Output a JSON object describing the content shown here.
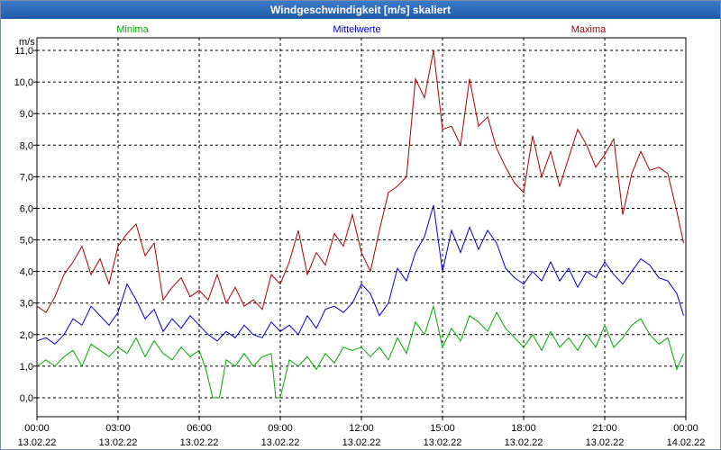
{
  "window": {
    "title": "Windgeschwindigkeit [m/s] skaliert"
  },
  "colors": {
    "minima": "#00aa00",
    "mittelwerte": "#0000cc",
    "maxima": "#aa0000",
    "grid": "#000000",
    "titlebar": "#2a66b4"
  },
  "chart_data": {
    "type": "line",
    "title": "Windgeschwindigkeit [m/s] skaliert",
    "ylabel": "m/s",
    "xlabel": "",
    "ylim": [
      -0.6,
      11.4
    ],
    "xlim": [
      "2022-02-13T00:00",
      "2022-02-14T00:00"
    ],
    "grid": true,
    "legend_position": "top",
    "y_ticks": [
      "0,0",
      "1,0",
      "2,0",
      "3,0",
      "4,0",
      "5,0",
      "6,0",
      "7,0",
      "8,0",
      "9,0",
      "10,0",
      "11,0"
    ],
    "x_ticks": [
      {
        "time": "00:00",
        "date": "13.02.22"
      },
      {
        "time": "03:00",
        "date": "13.02.22"
      },
      {
        "time": "06:00",
        "date": "13.02.22"
      },
      {
        "time": "09:00",
        "date": "13.02.22"
      },
      {
        "time": "12:00",
        "date": "13.02.22"
      },
      {
        "time": "15:00",
        "date": "13.02.22"
      },
      {
        "time": "18:00",
        "date": "13.02.22"
      },
      {
        "time": "21:00",
        "date": "13.02.22"
      },
      {
        "time": "00:00",
        "date": "14.02.22"
      }
    ],
    "series": [
      {
        "name": "Minima",
        "values": [
          [
            "00:00",
            1.0
          ],
          [
            "00:20",
            1.2
          ],
          [
            "00:40",
            1.0
          ],
          [
            "01:00",
            1.3
          ],
          [
            "01:20",
            1.5
          ],
          [
            "01:40",
            1.0
          ],
          [
            "02:00",
            1.7
          ],
          [
            "02:20",
            1.5
          ],
          [
            "02:40",
            1.3
          ],
          [
            "03:00",
            1.6
          ],
          [
            "03:20",
            1.4
          ],
          [
            "03:40",
            1.9
          ],
          [
            "04:00",
            1.3
          ],
          [
            "04:20",
            1.8
          ],
          [
            "04:40",
            1.4
          ],
          [
            "05:00",
            1.2
          ],
          [
            "05:20",
            1.6
          ],
          [
            "05:40",
            1.3
          ],
          [
            "06:00",
            1.5
          ],
          [
            "06:15",
            0.9
          ],
          [
            "06:30",
            0.0
          ],
          [
            "06:45",
            0.0
          ],
          [
            "07:00",
            1.2
          ],
          [
            "07:20",
            1.0
          ],
          [
            "07:40",
            1.4
          ],
          [
            "08:00",
            1.0
          ],
          [
            "08:20",
            1.3
          ],
          [
            "08:40",
            1.4
          ],
          [
            "08:50",
            0.0
          ],
          [
            "09:00",
            0.0
          ],
          [
            "09:20",
            1.2
          ],
          [
            "09:40",
            1.0
          ],
          [
            "10:00",
            1.3
          ],
          [
            "10:20",
            0.9
          ],
          [
            "10:40",
            1.4
          ],
          [
            "11:00",
            1.1
          ],
          [
            "11:20",
            1.6
          ],
          [
            "11:40",
            1.5
          ],
          [
            "12:00",
            1.6
          ],
          [
            "12:20",
            1.3
          ],
          [
            "12:40",
            1.6
          ],
          [
            "13:00",
            1.2
          ],
          [
            "13:20",
            1.9
          ],
          [
            "13:40",
            1.4
          ],
          [
            "14:00",
            2.4
          ],
          [
            "14:20",
            2.0
          ],
          [
            "14:40",
            2.9
          ],
          [
            "15:00",
            1.6
          ],
          [
            "15:20",
            2.2
          ],
          [
            "15:40",
            1.8
          ],
          [
            "16:00",
            2.6
          ],
          [
            "16:20",
            2.4
          ],
          [
            "16:40",
            2.1
          ],
          [
            "17:00",
            2.7
          ],
          [
            "17:20",
            2.2
          ],
          [
            "17:40",
            1.9
          ],
          [
            "18:00",
            1.6
          ],
          [
            "18:20",
            2.0
          ],
          [
            "18:40",
            1.5
          ],
          [
            "19:00",
            2.1
          ],
          [
            "19:20",
            1.6
          ],
          [
            "19:40",
            1.9
          ],
          [
            "20:00",
            1.5
          ],
          [
            "20:20",
            2.0
          ],
          [
            "20:40",
            1.6
          ],
          [
            "21:00",
            2.3
          ],
          [
            "21:20",
            1.6
          ],
          [
            "21:40",
            1.9
          ],
          [
            "22:00",
            2.3
          ],
          [
            "22:20",
            2.5
          ],
          [
            "22:40",
            2.0
          ],
          [
            "23:00",
            1.7
          ],
          [
            "23:20",
            1.9
          ],
          [
            "23:40",
            0.9
          ],
          [
            "23:55",
            1.4
          ]
        ]
      },
      {
        "name": "Mittelwerte",
        "values": [
          [
            "00:00",
            1.8
          ],
          [
            "00:20",
            1.9
          ],
          [
            "00:40",
            1.7
          ],
          [
            "01:00",
            2.0
          ],
          [
            "01:20",
            2.5
          ],
          [
            "01:40",
            2.3
          ],
          [
            "02:00",
            2.9
          ],
          [
            "02:20",
            2.6
          ],
          [
            "02:40",
            2.3
          ],
          [
            "03:00",
            2.7
          ],
          [
            "03:20",
            3.6
          ],
          [
            "03:40",
            3.1
          ],
          [
            "04:00",
            2.5
          ],
          [
            "04:20",
            2.8
          ],
          [
            "04:40",
            2.1
          ],
          [
            "05:00",
            2.5
          ],
          [
            "05:20",
            2.2
          ],
          [
            "05:40",
            2.6
          ],
          [
            "06:00",
            2.3
          ],
          [
            "06:20",
            2.0
          ],
          [
            "06:40",
            1.8
          ],
          [
            "07:00",
            2.1
          ],
          [
            "07:20",
            1.9
          ],
          [
            "07:40",
            2.3
          ],
          [
            "08:00",
            2.0
          ],
          [
            "08:20",
            1.9
          ],
          [
            "08:40",
            2.4
          ],
          [
            "09:00",
            2.1
          ],
          [
            "09:20",
            2.3
          ],
          [
            "09:40",
            2.0
          ],
          [
            "10:00",
            2.6
          ],
          [
            "10:20",
            2.2
          ],
          [
            "10:40",
            2.8
          ],
          [
            "11:00",
            2.9
          ],
          [
            "11:20",
            2.7
          ],
          [
            "11:40",
            3.0
          ],
          [
            "12:00",
            3.6
          ],
          [
            "12:20",
            3.3
          ],
          [
            "12:40",
            2.6
          ],
          [
            "13:00",
            3.0
          ],
          [
            "13:20",
            4.1
          ],
          [
            "13:40",
            3.7
          ],
          [
            "14:00",
            4.6
          ],
          [
            "14:20",
            5.1
          ],
          [
            "14:40",
            6.1
          ],
          [
            "15:00",
            4.0
          ],
          [
            "15:20",
            5.3
          ],
          [
            "15:40",
            4.6
          ],
          [
            "16:00",
            5.4
          ],
          [
            "16:20",
            4.7
          ],
          [
            "16:40",
            5.3
          ],
          [
            "17:00",
            4.9
          ],
          [
            "17:20",
            4.1
          ],
          [
            "17:40",
            3.8
          ],
          [
            "18:00",
            3.6
          ],
          [
            "18:20",
            4.0
          ],
          [
            "18:40",
            3.7
          ],
          [
            "19:00",
            4.3
          ],
          [
            "19:20",
            3.7
          ],
          [
            "19:40",
            4.1
          ],
          [
            "20:00",
            3.5
          ],
          [
            "20:20",
            4.0
          ],
          [
            "20:40",
            3.8
          ],
          [
            "21:00",
            4.3
          ],
          [
            "21:20",
            3.9
          ],
          [
            "21:40",
            3.6
          ],
          [
            "22:00",
            4.0
          ],
          [
            "22:20",
            4.4
          ],
          [
            "22:40",
            4.2
          ],
          [
            "23:00",
            3.8
          ],
          [
            "23:20",
            3.7
          ],
          [
            "23:40",
            3.3
          ],
          [
            "23:55",
            2.6
          ]
        ]
      },
      {
        "name": "Maxima",
        "values": [
          [
            "00:00",
            2.9
          ],
          [
            "00:20",
            2.7
          ],
          [
            "00:40",
            3.2
          ],
          [
            "01:00",
            3.9
          ],
          [
            "01:20",
            4.3
          ],
          [
            "01:40",
            4.8
          ],
          [
            "02:00",
            3.9
          ],
          [
            "02:20",
            4.4
          ],
          [
            "02:40",
            3.6
          ],
          [
            "03:00",
            4.8
          ],
          [
            "03:20",
            5.2
          ],
          [
            "03:40",
            5.5
          ],
          [
            "04:00",
            4.5
          ],
          [
            "04:20",
            4.9
          ],
          [
            "04:40",
            3.1
          ],
          [
            "05:00",
            3.5
          ],
          [
            "05:20",
            3.8
          ],
          [
            "05:40",
            3.2
          ],
          [
            "06:00",
            3.4
          ],
          [
            "06:20",
            3.1
          ],
          [
            "06:40",
            3.9
          ],
          [
            "07:00",
            3.0
          ],
          [
            "07:20",
            3.5
          ],
          [
            "07:40",
            2.9
          ],
          [
            "08:00",
            3.1
          ],
          [
            "08:20",
            2.8
          ],
          [
            "08:40",
            3.9
          ],
          [
            "09:00",
            3.6
          ],
          [
            "09:20",
            4.3
          ],
          [
            "09:40",
            5.3
          ],
          [
            "10:00",
            3.9
          ],
          [
            "10:20",
            4.6
          ],
          [
            "10:40",
            4.2
          ],
          [
            "11:00",
            5.2
          ],
          [
            "11:20",
            4.8
          ],
          [
            "11:40",
            5.8
          ],
          [
            "12:00",
            4.6
          ],
          [
            "12:20",
            4.0
          ],
          [
            "12:40",
            5.3
          ],
          [
            "13:00",
            6.5
          ],
          [
            "13:20",
            6.7
          ],
          [
            "13:40",
            7.0
          ],
          [
            "14:00",
            10.1
          ],
          [
            "14:20",
            9.5
          ],
          [
            "14:40",
            11.0
          ],
          [
            "15:00",
            8.5
          ],
          [
            "15:20",
            8.6
          ],
          [
            "15:40",
            8.0
          ],
          [
            "16:00",
            10.1
          ],
          [
            "16:20",
            8.6
          ],
          [
            "16:40",
            8.9
          ],
          [
            "17:00",
            7.9
          ],
          [
            "17:20",
            7.3
          ],
          [
            "17:40",
            6.8
          ],
          [
            "18:00",
            6.5
          ],
          [
            "18:20",
            8.3
          ],
          [
            "18:40",
            7.0
          ],
          [
            "19:00",
            7.8
          ],
          [
            "19:20",
            6.7
          ],
          [
            "19:40",
            7.6
          ],
          [
            "20:00",
            8.5
          ],
          [
            "20:20",
            8.0
          ],
          [
            "20:40",
            7.3
          ],
          [
            "21:00",
            7.7
          ],
          [
            "21:20",
            8.2
          ],
          [
            "21:40",
            5.8
          ],
          [
            "22:00",
            7.1
          ],
          [
            "22:20",
            7.8
          ],
          [
            "22:40",
            7.2
          ],
          [
            "23:00",
            7.3
          ],
          [
            "23:20",
            7.1
          ],
          [
            "23:40",
            5.9
          ],
          [
            "23:55",
            4.9
          ]
        ]
      }
    ]
  }
}
